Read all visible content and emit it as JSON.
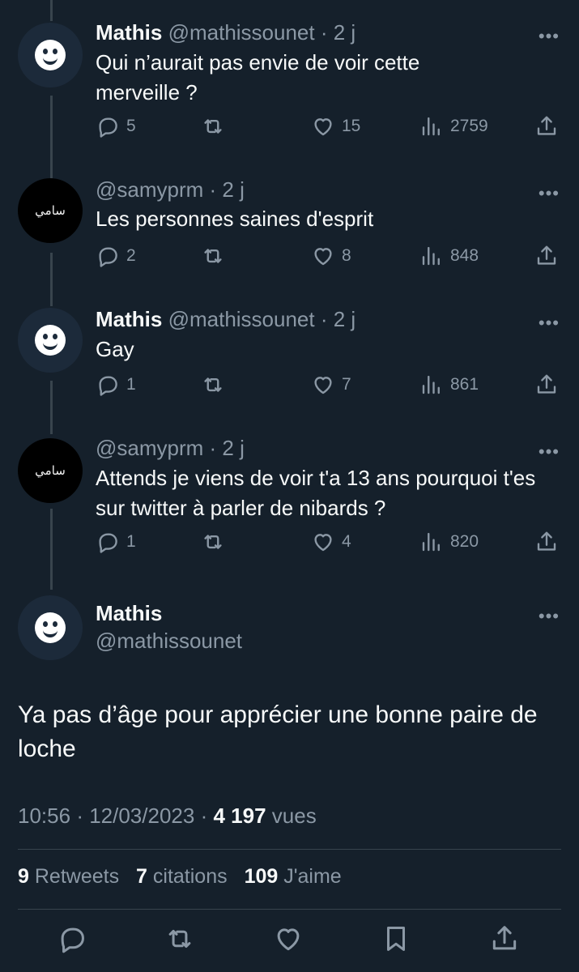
{
  "replies": [
    {
      "avatar": "smiley-avatar",
      "name": "Mathis",
      "handle": "@mathissounet",
      "time": "· 2 j",
      "text": "Qui n’aurait pas envie de voir cette merveille ?",
      "replies": "5",
      "retweets": "",
      "likes": "15",
      "views": "2759"
    },
    {
      "avatar": "arabic-text-avatar",
      "avatar_text": "سامي",
      "name": "",
      "handle": "@samyprm",
      "time": "· 2 j",
      "text": "Les personnes saines d'esprit",
      "replies": "2",
      "retweets": "",
      "likes": "8",
      "views": "848"
    },
    {
      "avatar": "smiley-avatar",
      "name": "Mathis",
      "handle": "@mathissounet",
      "time": "· 2 j",
      "text": "Gay",
      "replies": "1",
      "retweets": "",
      "likes": "7",
      "views": "861"
    },
    {
      "avatar": "arabic-text-avatar",
      "avatar_text": "سامي",
      "name": "",
      "handle": "@samyprm",
      "time": "· 2 j",
      "text": "Attends je viens de voir t'a 13 ans pourquoi t'es sur twitter à parler de nibards ?",
      "replies": "1",
      "retweets": "",
      "likes": "4",
      "views": "820"
    }
  ],
  "main_tweet": {
    "name": "Mathis",
    "handle": "@mathissounet",
    "text": "Ya pas d’âge pour apprécier une bonne paire de loche",
    "time": "10:56",
    "date": "12/03/2023",
    "views_count": "4 197",
    "views_label": "vues",
    "retweets_count": "9",
    "retweets_label": "Retweets",
    "quotes_count": "7",
    "quotes_label": "citations",
    "likes_count": "109",
    "likes_label": "J'aime"
  },
  "more_label": "•••",
  "colors": {
    "background": "#15202b",
    "text": "#f7f9f9",
    "muted": "#8b98a5",
    "divider": "#38444d"
  }
}
